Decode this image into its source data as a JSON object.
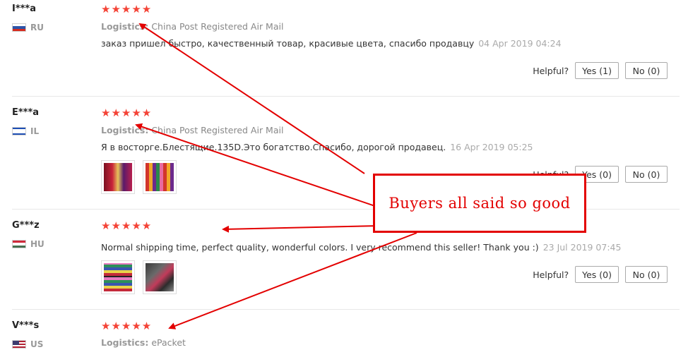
{
  "helpful_label": "Helpful?",
  "logistics_label": "Logistics:",
  "annotation": {
    "text": "Buyers all said so good",
    "color": "#e30000"
  },
  "rating_color": "#f44336",
  "reviews": [
    {
      "user": "I***a",
      "country": "RU",
      "flag_icon": "russia-flag-icon",
      "stars": 5,
      "star_text": "★★★★★",
      "logistics": "China Post Registered Air Mail",
      "text": "заказ пришел быстро, качественный товар, красивые цвета, спасибо продавцу",
      "date": "04 Apr 2019 04:24",
      "photos": [],
      "yes": "Yes (1)",
      "no": "No (0)"
    },
    {
      "user": "E***a",
      "country": "IL",
      "flag_icon": "israel-flag-icon",
      "stars": 5,
      "star_text": "★★★★★",
      "logistics": "China Post Registered Air Mail",
      "text": "Я в восторге.Блестящие.135D.Это богатство.Спасибо, дорогой продавец.",
      "date": "16 Apr 2019 05:25",
      "photos": [
        "thread-spools-photo",
        "thread-box-photo"
      ],
      "yes": "Yes (0)",
      "no": "No (0)"
    },
    {
      "user": "G***z",
      "country": "HU",
      "flag_icon": "hungary-flag-icon",
      "stars": 5,
      "star_text": "★★★★★",
      "logistics": "",
      "text": "Normal shipping time, perfect quality, wonderful colors. I very recommend this seller! Thank you :)",
      "date": "23 Jul 2019 07:45",
      "photos": [
        "thread-grid-photo",
        "thread-package-photo"
      ],
      "yes": "Yes (0)",
      "no": "No (0)"
    },
    {
      "user": "V***s",
      "country": "US",
      "flag_icon": "usa-flag-icon",
      "stars": 5,
      "star_text": "★★★★★",
      "logistics": "ePacket",
      "text": "",
      "date": "",
      "photos": [],
      "yes": "",
      "no": ""
    }
  ]
}
